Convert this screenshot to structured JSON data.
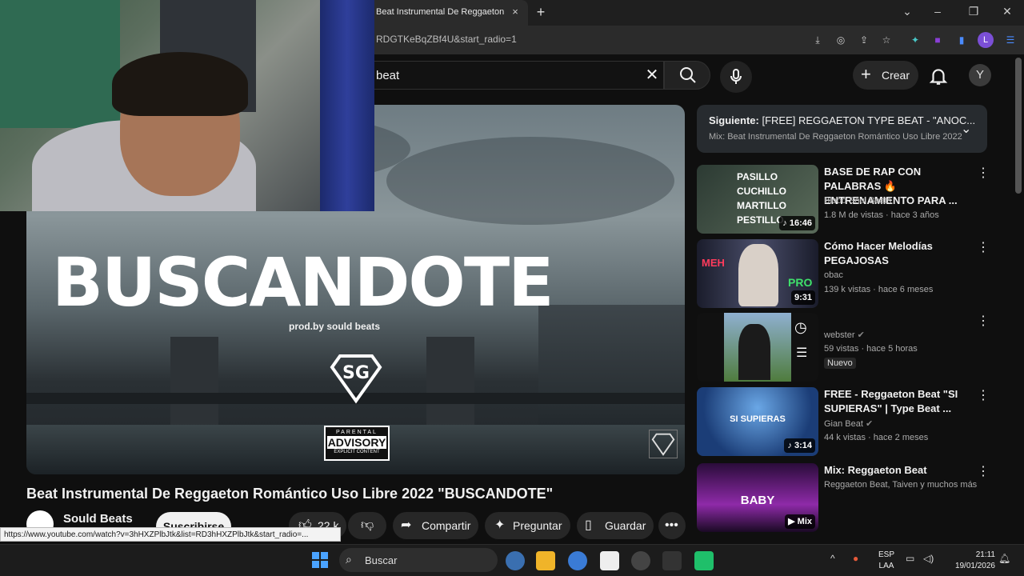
{
  "browser": {
    "tab_title": "Beat Instrumental De Reggaeton",
    "tab_close": "×",
    "new_tab": "+",
    "url": "RDGTKeBqZBf4U&start_radio=1",
    "profile_initial": "L"
  },
  "youtube": {
    "search_query": "beat",
    "create_label": "Crear",
    "avatar_initial": "Y"
  },
  "player": {
    "overlay_title": "BUSCANDOTE",
    "overlay_prodby": "prod.by sould beats",
    "advisory_line1": "PARENTAL",
    "advisory_line2": "ADVISORY",
    "advisory_line3": "EXPLICIT CONTENT"
  },
  "video": {
    "title": "Beat Instrumental De Reggaeton Romántico Uso Libre 2022 \"BUSCANDOTE\"",
    "channel": "Sould Beats",
    "subscribe_label": "Suscribirse",
    "likes": "22 k",
    "share_label": "Compartir",
    "ask_label": "Preguntar",
    "save_label": "Guardar"
  },
  "status_url": "https://www.youtube.com/watch?v=3hHXZPlbJtk&list=RD3hHXZPlbJtk&start_radio=...",
  "up_next": {
    "label": "Siguiente:",
    "title": "[FREE] REGGAETON TYPE BEAT - \"ANOC...",
    "mix": "Mix: Beat Instrumental De Reggaeton Romántico Uso Libre 2022"
  },
  "recommendations": [
    {
      "title": "BASE DE RAP CON PALABRAS 🔥ENTRENAMIENTO PARA ...",
      "channel": "Blood Soul Beats",
      "meta": "1.8 M de vistas · hace 3 años",
      "duration": "16:46",
      "thumb_words": [
        "PASILLO",
        "CUCHILLO",
        "MARTILLO",
        "PESTILLO"
      ]
    },
    {
      "title": "Cómo Hacer Melodías PEGAJOSAS",
      "channel": "obac",
      "meta": "139 k vistas · hace 6 meses",
      "duration": "9:31",
      "thumb_left": "MEH",
      "thumb_right": "PRO"
    },
    {
      "title": "",
      "channel": "webster",
      "meta": "59 vistas · hace 5 horas",
      "badge": "Nuevo"
    },
    {
      "title": "FREE - Reggaeton Beat \"SI SUPIERAS\" | Type Beat ...",
      "channel": "Gian Beat",
      "meta": "44 k vistas · hace 2 meses",
      "duration": "3:14",
      "thumb_text": "SI SUPIERAS"
    },
    {
      "title": "Mix: Reggaeton Beat",
      "channel": "Reggaeton Beat, Taiven y muchos más",
      "duration": "Mix",
      "thumb_text": "BABY"
    }
  ],
  "taskbar": {
    "search_label": "Buscar",
    "lang_1": "ESP",
    "lang_2": "LAA",
    "time": "21:11",
    "date": "19/01/2026"
  }
}
